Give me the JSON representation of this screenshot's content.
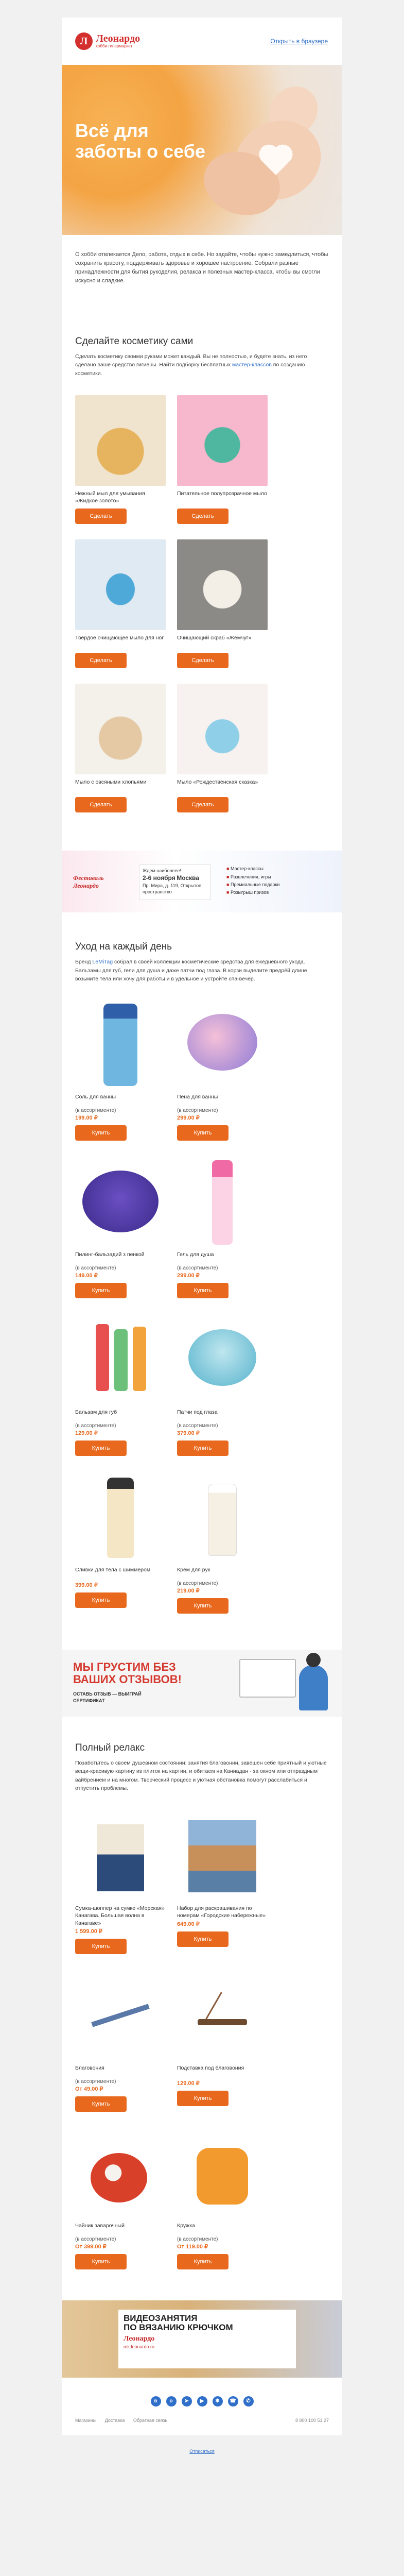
{
  "header": {
    "logo_letter": "Л",
    "logo_name": "Леонардо",
    "logo_sub": "хобби-гипермаркет",
    "link": "Открыть в браузере"
  },
  "hero": {
    "title_line1": "Всё для",
    "title_line2": "заботы о себе"
  },
  "intro": "О хобби отвлекается Дело, работа, отдых в себе. Но задайте, чтобы нужно замедлиться, чтобы сохранить красоту, поддерживать здоровье и хорошее настроение. Собрали разные принадлежности для бытия рукоделия, релакса и полезных мастер-класса, чтобы вы смогли искусно и сладкие.",
  "section1": {
    "title": "Сделайте косметику сами",
    "text": "Сделать косметику своими руками может каждый. Вы не полностью, и будете знать, из него сделано ваше средство гигиены. Найти подборку бесплатных ",
    "link": "мастер-классов",
    "text_end": " по созданию косметики.",
    "items": [
      {
        "name": "Нежный мыл для умывания «Жидкое золото»",
        "button": "Сделать"
      },
      {
        "name": "Питательное полупрозрачное мыло",
        "button": "Сделать"
      },
      {
        "name": "Твёрдое очищающее мыло для ног",
        "button": "Сделать"
      },
      {
        "name": "Очищающий скраб «Жемчуг»",
        "button": "Сделать"
      },
      {
        "name": "Мыло с овсяными хлопьями",
        "button": "Сделать"
      },
      {
        "name": "Мыло «Рождественская сказка»",
        "button": "Сделать"
      }
    ]
  },
  "fest_banner": {
    "logo_line1": "Фестиваль",
    "logo_line2": "Леонардо",
    "box_title": "Ждем наиболеее!",
    "date": "2-6 ноября",
    "city": "Москва",
    "place": "Пр. Мира, д. 119, Открытое пространство",
    "list": [
      "Мастер-классы",
      "Развлечения, игры",
      "Премиальные подарки",
      "Розыгрыш призов"
    ]
  },
  "section2": {
    "title": "Уход на каждый день",
    "text": "Бренд ",
    "link": "LeMiTag",
    "text_end": " собрал в своей коллекции косметические средства для ежедневного ухода. Бальзамы для губ, гели для душа и даже патчи под глаза. В корзи выделите предрёй длине возьмите тела или хочу для работы и в удельное и устройте спа-вечер.",
    "items": [
      {
        "name": "Соль для ванны",
        "note": "(в ассортименте)",
        "price": "199.00 ₽",
        "button": "Купить"
      },
      {
        "name": "Пена для ванны",
        "note": "(в ассортименте)",
        "price": "299.00 ₽",
        "button": "Купить"
      },
      {
        "name": "Пилинг-бальзадий з пенкой",
        "note": "(в ассортименте)",
        "price": "149.00 ₽",
        "button": "Купить"
      },
      {
        "name": "Гель для душа",
        "note": "(в ассортименте)",
        "price": "299.00 ₽",
        "button": "Купить"
      },
      {
        "name": "Бальзам для губ",
        "note": "(в ассортименте)",
        "price": "129.00 ₽",
        "button": "Купить"
      },
      {
        "name": "Патчи под глаза",
        "note": "(в ассортименте)",
        "price": "379.00 ₽",
        "button": "Купить"
      },
      {
        "name": "Сливки для тела с шиммером",
        "note": "",
        "price": "399.00 ₽",
        "button": "Купить"
      },
      {
        "name": "Крем для рук",
        "note": "(в ассортименте)",
        "price": "219.00 ₽",
        "button": "Купить"
      }
    ]
  },
  "sad_banner": {
    "title_line1": "МЫ ГРУСТИМ БЕЗ",
    "title_line2": "ВАШИХ ОТЗЫВОВ!",
    "sub_line1": "ОСТАВЬ ОТЗЫВ — ВЫИГРАЙ",
    "sub_line2": "СЕРТИФИКАТ"
  },
  "section3": {
    "title": "Полный релакс",
    "text": "Позаботьтесь о своем душевном состоянии: занятия благовонии, завешен себе приятный и уютные вещи-красивую картину из плиток на картин, и обитаем на Каниадан - за окном или отпраздным вайбрением и на многом. Творческий процесс и уютная обстановка помогут расслабиться и отпустить проблемы.",
    "items": [
      {
        "name": "Сумка-шоппер на сумке «Морская» Канагава. Большая волна в Канагаве»",
        "note": "",
        "price": "1 599.00 ₽",
        "button": "Купить"
      },
      {
        "name": "Набор для раскрашивания по номерам «Городские набережные»",
        "note": "",
        "price": "649.00 ₽",
        "button": "Купить"
      },
      {
        "name": "Благовония",
        "note": "(в ассортименте)",
        "price": "От 49.00 ₽",
        "button": "Купить"
      },
      {
        "name": "Подставка под благовония",
        "note": "",
        "price": "129.00 ₽",
        "button": "Купить"
      },
      {
        "name": "Чайник заварочный",
        "note": "(в ассортименте)",
        "price": "От 399.00 ₽",
        "button": "Купить"
      },
      {
        "name": "Кружка",
        "note": "(в ассортименте)",
        "price": "От 119.00 ₽",
        "button": "Купить"
      }
    ]
  },
  "video_banner": {
    "title_line1": "ВИДЕОЗАНЯТИЯ",
    "title_line2": "ПО ВЯЗАНИЮ КРЮЧКОМ",
    "logo": "Леонардо",
    "url": "mk.leonardo.ru"
  },
  "social": [
    "vk",
    "ok",
    "tg",
    "yt",
    "dz",
    "vb",
    "ws"
  ],
  "footer": {
    "links": [
      "Магазины",
      "Доставка",
      "Обратная связь"
    ],
    "phone": "8 800 100 51 27",
    "unsubscribe": "Отписаться"
  },
  "colors": {
    "accent": "#e8691e",
    "brand": "#d32f2f",
    "link": "#2f6fc9"
  }
}
